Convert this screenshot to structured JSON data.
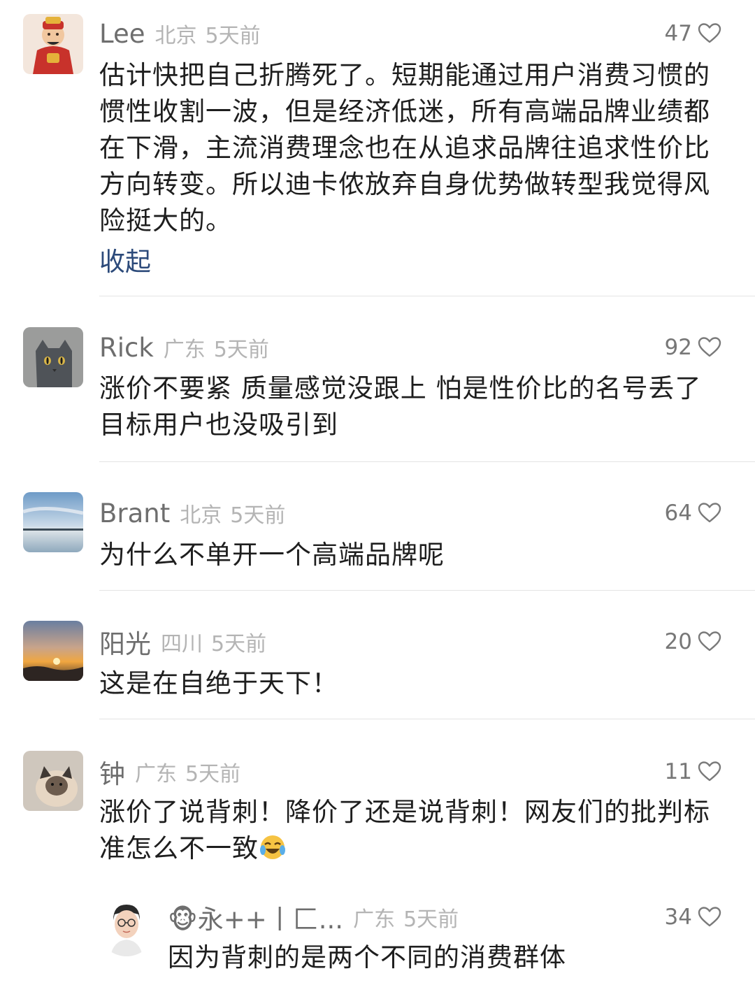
{
  "comments": [
    {
      "name": "Lee",
      "location": "北京",
      "time": "5天前",
      "likes": "47",
      "text": "估计快把自己折腾死了。短期能通过用户消费习惯的惯性收割一波，但是经济低迷，所有高端品牌业绩都在下滑，主流消费理念也在从追求品牌往追求性价比方向转变。所以迪卡侬放弃自身优势做转型我觉得风险挺大的。",
      "collapse_label": "收起"
    },
    {
      "name": "Rick",
      "location": "广东",
      "time": "5天前",
      "likes": "92",
      "text": "涨价不要紧 质量感觉没跟上  怕是性价比的名号丢了 目标用户也没吸引到"
    },
    {
      "name": "Brant",
      "location": "北京",
      "time": "5天前",
      "likes": "64",
      "text": "为什么不单开一个高端品牌呢"
    },
    {
      "name": "阳光",
      "location": "四川",
      "time": "5天前",
      "likes": "20",
      "text": "这是在自绝于天下！"
    },
    {
      "name": "钟",
      "location": "广东",
      "time": "5天前",
      "likes": "11",
      "text": "涨价了说背刺！降价了还是说背刺！网友们的批判标准怎么不一致"
    }
  ],
  "reply": {
    "name": "🐵永++丨匚...",
    "location": "广东",
    "time": "5天前",
    "likes": "34",
    "text": "因为背刺的是两个不同的消费群体"
  },
  "icons": {
    "like": "heart-outline-icon",
    "emoji": "laughing-crying-face-icon"
  },
  "colors": {
    "name": "#6e6e6e",
    "meta": "#b4b4b4",
    "text": "#1e1e1e",
    "link": "#2c4a7a",
    "divider": "#e4e4e4"
  }
}
